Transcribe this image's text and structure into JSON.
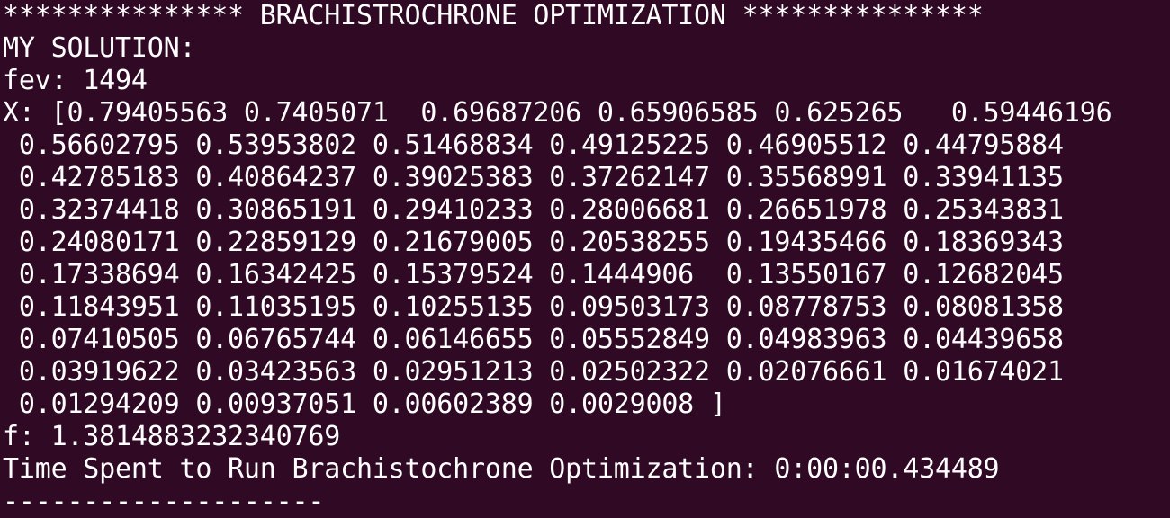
{
  "terminal": {
    "background": "#300a24",
    "foreground": "#ffffff",
    "lines": [
      "*************** BRACHISTROCHRONE OPTIMIZATION ***************",
      "MY SOLUTION:",
      "fev: 1494",
      "X: [0.79405563 0.7405071  0.69687206 0.65906585 0.625265   0.59446196",
      " 0.56602795 0.53953802 0.51468834 0.49125225 0.46905512 0.44795884",
      " 0.42785183 0.40864237 0.39025383 0.37262147 0.35568991 0.33941135",
      " 0.32374418 0.30865191 0.29410233 0.28006681 0.26651978 0.25343831",
      " 0.24080171 0.22859129 0.21679005 0.20538255 0.19435466 0.18369343",
      " 0.17338694 0.16342425 0.15379524 0.1444906  0.13550167 0.12682045",
      " 0.11843951 0.11035195 0.10255135 0.09503173 0.08778753 0.08081358",
      " 0.07410505 0.06765744 0.06146655 0.05552849 0.04983963 0.04439658",
      " 0.03919622 0.03423563 0.02951213 0.02502322 0.02076661 0.01674021",
      " 0.01294209 0.00937051 0.00602389 0.0029008 ]",
      "f: 1.3814883232340769",
      "Time Spent to Run Brachistochrone Optimization: 0:00:00.434489",
      "--------------------"
    ]
  }
}
